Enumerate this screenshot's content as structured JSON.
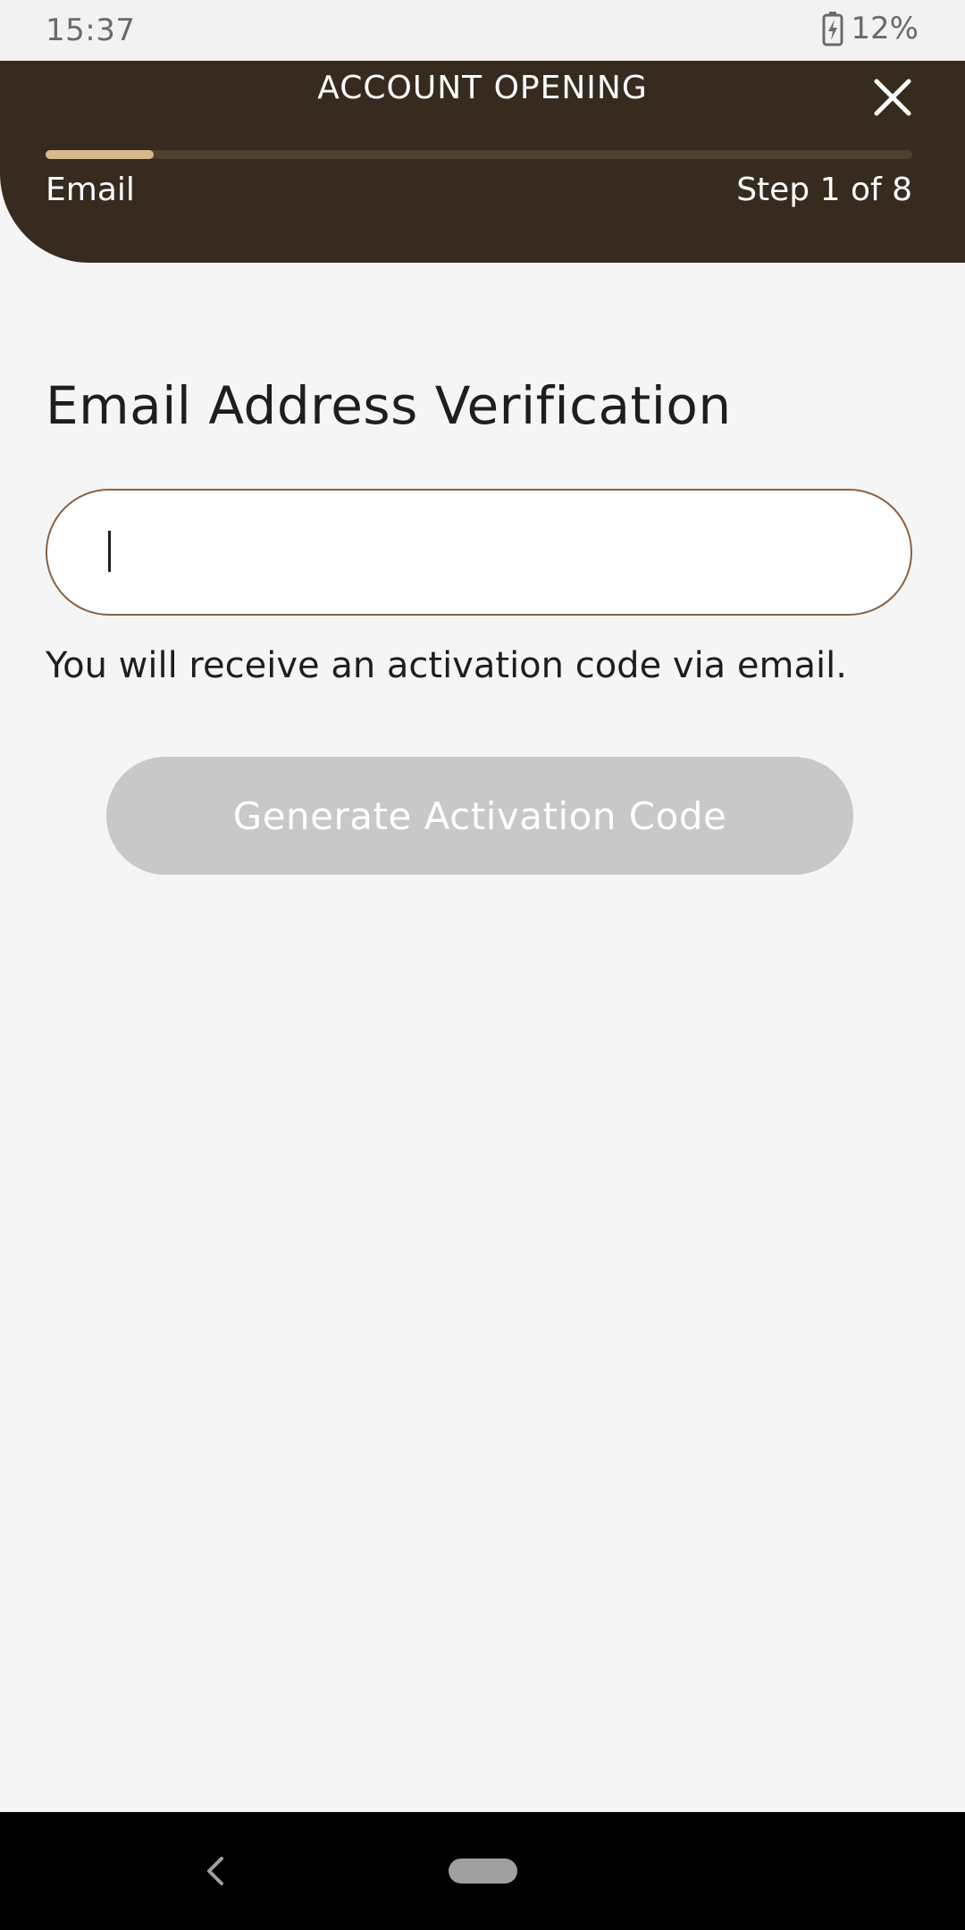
{
  "status_bar": {
    "time": "15:37",
    "battery_percent": "12%",
    "battery_icon": "battery-charging-icon"
  },
  "header": {
    "title": "ACCOUNT OPENING",
    "close_icon": "close-icon",
    "step_name": "Email",
    "step_counter": "Step 1 of 8",
    "progress": 0.125
  },
  "main": {
    "title": "Email Address Verification",
    "email_input": {
      "value": "",
      "placeholder": ""
    },
    "helper_text": "You will receive an activation code via email.",
    "generate_button_label": "Generate Activation Code"
  },
  "nav_bar": {
    "back_icon": "back-chevron-icon",
    "home_icon": "home-pill-icon"
  },
  "colors": {
    "header_bg": "#372b20",
    "progress_fill": "#d8b98e",
    "input_border": "#8a6240",
    "button_disabled_bg": "#c8c8c8"
  }
}
